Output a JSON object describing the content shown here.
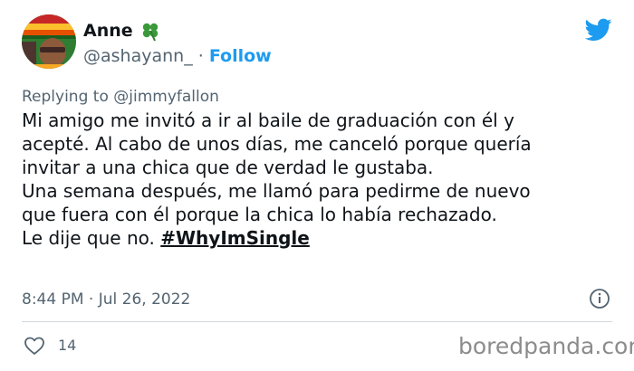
{
  "author": {
    "name": "Anne",
    "handle": "@ashayann_",
    "separator": "·",
    "follow_label": "Follow",
    "emoji_icon": "four-leaf-clover-icon"
  },
  "reply": {
    "prefix": "Replying to",
    "to_handle": "@jimmyfallon"
  },
  "tweet": {
    "lines": [
      "Mi amigo me invitó a ir al baile de graduación con él y",
      "acepté. Al cabo de unos días, me canceló porque quería",
      "invitar a una chica que de verdad le gustaba.",
      "Una semana después, me llamó para pedirme de nuevo",
      "que fuera con él porque la chica lo había rechazado."
    ],
    "last_line_text": "Le dije que no.",
    "hashtag": "#WhyImSingle",
    "timestamp": "8:44 PM · Jul 26, 2022"
  },
  "engagement": {
    "likes": "14"
  },
  "watermark": "boredpanda.com",
  "colors": {
    "twitter_blue": "#1d9bf0",
    "secondary_text": "#536471",
    "primary_text": "#0f1419",
    "divider": "#cfd9de"
  },
  "icons": [
    "twitter-bird-icon",
    "info-icon",
    "heart-icon"
  ]
}
